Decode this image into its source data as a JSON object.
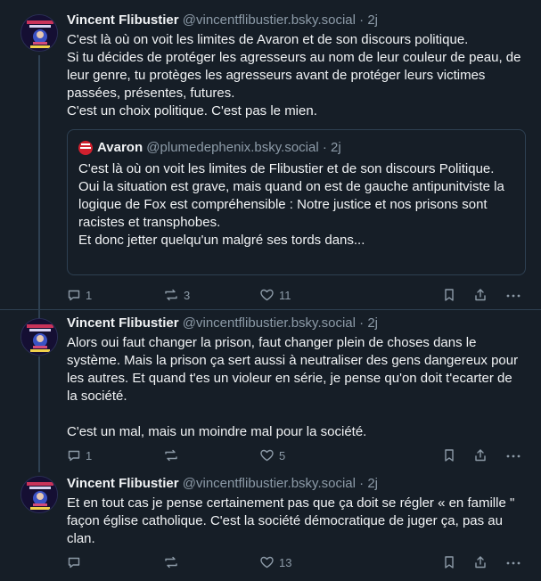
{
  "posts": [
    {
      "author_name": "Vincent Flibustier",
      "author_handle": "@vincentflibustier.bsky.social",
      "separator": "·",
      "time": "2j",
      "text": "C'est là où on voit les limites de Avaron et de son discours politique.\nSi tu décides de protéger les agresseurs au nom de leur couleur de peau, de leur genre, tu protèges les agresseurs avant de protéger leurs victimes passées, présentes, futures.\nC'est un choix politique. C'est pas le mien.",
      "quote": {
        "author_name": "Avaron",
        "author_handle": "@plumedephenix.bsky.social",
        "separator": "·",
        "time": "2j",
        "text": "C'est là où on voit les limites de Flibustier et de son discours Politique.\nOui la situation est grave, mais quand on est de gauche antipunitviste la logique de Fox est compréhensible : Notre justice et nos prisons sont racistes et transphobes.\nEt donc jetter quelqu'un malgré ses tords dans..."
      },
      "reply_count": "1",
      "repost_count": "3",
      "like_count": "11"
    },
    {
      "author_name": "Vincent Flibustier",
      "author_handle": "@vincentflibustier.bsky.social",
      "separator": "·",
      "time": "2j",
      "text": "Alors oui faut changer la prison, faut changer plein de choses dans le système. Mais la prison ça sert aussi à neutraliser des gens dangereux pour les autres. Et quand t'es un violeur en série, je pense qu'on doit t'ecarter de la société.\n\nC'est un mal, mais un moindre mal pour la société.",
      "reply_count": "1",
      "repost_count": "",
      "like_count": "5"
    },
    {
      "author_name": "Vincent Flibustier",
      "author_handle": "@vincentflibustier.bsky.social",
      "separator": "·",
      "time": "2j",
      "text": "Et en tout cas je pense certainement pas que ça doit se régler « en famille \" façon église catholique. C'est la société démocratique de juger ça, pas au clan.",
      "reply_count": "",
      "repost_count": "",
      "like_count": "13"
    }
  ],
  "icons": {
    "reply": "reply-icon",
    "repost": "repost-icon",
    "like": "heart-icon",
    "bookmark": "bookmark-icon",
    "share": "share-icon",
    "more": "more-icon"
  },
  "colors": {
    "background": "#161e27",
    "text": "#f1f3f5",
    "muted": "#8d9ba8",
    "border": "#2e4052"
  }
}
